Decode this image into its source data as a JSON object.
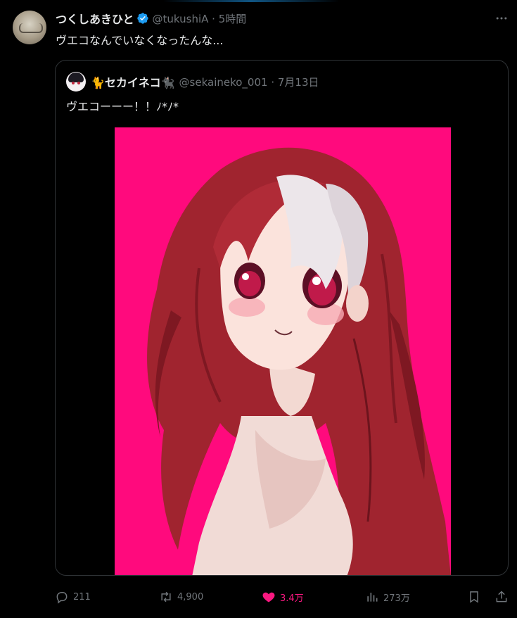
{
  "tweet": {
    "author_name": "つくしあきひと",
    "handle_time": "@tukushiA · 5時間",
    "text": "ヴエコなんでいなくなったんな..."
  },
  "quote": {
    "author_name": "🐈セカイネコ🐈‍⬛",
    "handle_time": "@sekaineko_001 · 7月13日",
    "text": "ヴエコーーー！！ﾉ*ﾉ*"
  },
  "actions": {
    "replies": "211",
    "reposts": "4,900",
    "likes": "3.4万",
    "views": "273万"
  },
  "colors": {
    "background": "#000000",
    "text": "#e7e9ea",
    "muted": "#71767b",
    "verified": "#1d9bf0",
    "like": "#f91880",
    "art_background": "#ff0a7d"
  },
  "icons": [
    "more-icon",
    "verified-badge-icon",
    "reply-icon",
    "repost-icon",
    "like-icon",
    "views-icon",
    "bookmark-icon",
    "share-icon"
  ]
}
